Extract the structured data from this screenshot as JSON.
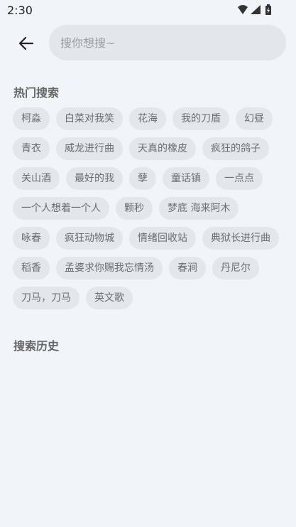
{
  "status_bar": {
    "time": "2:30"
  },
  "search": {
    "placeholder": "搜你想搜~",
    "value": ""
  },
  "hot_search": {
    "title": "热门搜索",
    "rows": [
      [
        "柯淼",
        "白菜对我笑",
        "花海",
        "我的刀盾",
        "幻昼"
      ],
      [
        "青衣",
        "威龙进行曲",
        "天真的橡皮",
        "疯狂的鸽子"
      ],
      [
        "关山酒",
        "最好的我",
        "孽",
        "童话镇",
        "一点点"
      ],
      [
        "一个人想着一个人",
        "颗秒",
        "梦底 海来阿木"
      ],
      [
        "咏春",
        "疯狂动物城",
        "情绪回收站",
        "典狱长进行曲"
      ],
      [
        "稻香",
        "孟婆求你赐我忘情汤",
        "春涧",
        "丹尼尔"
      ],
      [
        "刀马，刀马",
        "英文歌"
      ]
    ]
  },
  "search_history": {
    "title": "搜索历史",
    "items": []
  },
  "icons": {
    "back": "arrow-left-icon",
    "wifi": "wifi-icon",
    "signal": "cellular-signal-icon",
    "battery": "battery-charging-icon"
  }
}
